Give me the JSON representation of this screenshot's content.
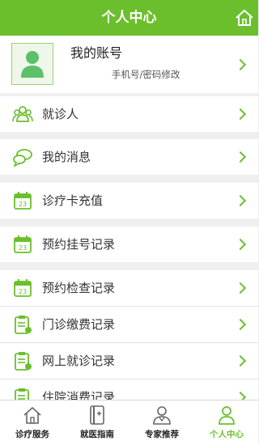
{
  "header": {
    "title": "个人中心",
    "home_icon": "home-icon"
  },
  "account": {
    "title": "我的账号",
    "subtitle": "手机号/密码修改",
    "avatar_icon": "user-avatar-icon"
  },
  "menu": [
    {
      "label": "就诊人",
      "icon": "patients-icon"
    },
    {
      "label": "我的消息",
      "icon": "message-bubbles-icon"
    },
    {
      "label": "诊疗卡充值",
      "icon": "calendar-icon"
    },
    {
      "label": "预约挂号记录",
      "icon": "calendar-icon"
    },
    {
      "label": "预约检查记录",
      "icon": "calendar-icon"
    },
    {
      "label": "门诊缴费记录",
      "icon": "clipboard-icon"
    },
    {
      "label": "网上就诊记录",
      "icon": "clipboard-icon"
    },
    {
      "label": "住院消费记录",
      "icon": "clipboard-icon"
    }
  ],
  "tabs": [
    {
      "label": "诊疗服务",
      "icon": "house-icon",
      "active": false
    },
    {
      "label": "就医指南",
      "icon": "guide-book-icon",
      "active": false
    },
    {
      "label": "专家推荐",
      "icon": "doctor-icon",
      "active": false
    },
    {
      "label": "个人中心",
      "icon": "person-icon",
      "active": true
    }
  ],
  "colors": {
    "accent": "#6bbf2c",
    "background": "#efefef"
  }
}
